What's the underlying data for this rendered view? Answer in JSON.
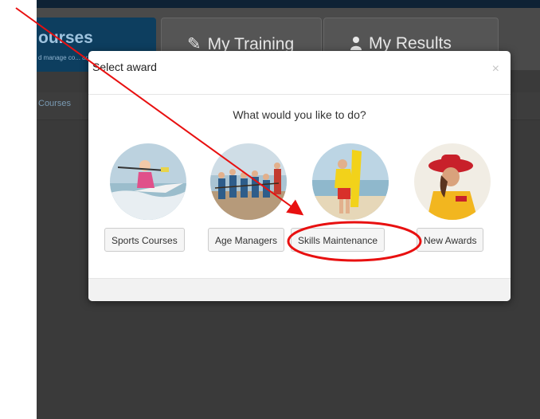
{
  "nav": {
    "active_tab": {
      "label": "ourses",
      "subtitle": "d manage co... ance"
    },
    "tabs": [
      {
        "label": "My Training",
        "icon": "pencil-icon"
      },
      {
        "label": "My Results",
        "icon": "user-icon"
      }
    ],
    "breadcrumb": "Courses"
  },
  "modal": {
    "title": "Select award",
    "close_label": "×",
    "question": "What would you like to do?",
    "options": [
      {
        "label": "Sports Courses",
        "image": "kayaker-photo"
      },
      {
        "label": "Age Managers",
        "image": "group-tug-of-war-photo"
      },
      {
        "label": "Skills Maintenance",
        "image": "lifesaver-with-board-photo"
      },
      {
        "label": "New Awards",
        "image": "lifeguard-in-hat-photo"
      }
    ]
  },
  "annotations": {
    "arrow_color": "#e81010",
    "circle_color": "#e81010",
    "highlighted_option": "Skills Maintenance"
  },
  "colors": {
    "header": "#0d3e5f",
    "background": "#3a3a3a",
    "accent": "#e81010"
  }
}
